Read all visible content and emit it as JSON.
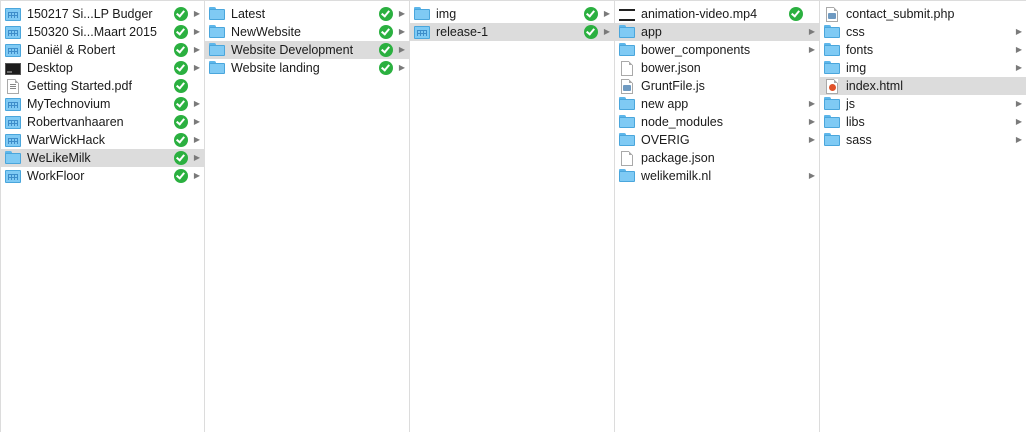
{
  "colors": {
    "selection": "#dcdcdc",
    "check": "#2bb040",
    "folder": "#7fcaf4",
    "border": "#dcdcdc"
  },
  "columns": [
    {
      "items": [
        {
          "name": "150217 Si...LP Budger",
          "icon": "project-folder-icon",
          "synced": true,
          "has_children": true,
          "selected": false
        },
        {
          "name": "150320 Si...Maart 2015",
          "icon": "project-folder-icon",
          "synced": true,
          "has_children": true,
          "selected": false
        },
        {
          "name": "Daniël & Robert",
          "icon": "project-folder-icon",
          "synced": true,
          "has_children": true,
          "selected": false
        },
        {
          "name": "Desktop",
          "icon": "desktop-icon",
          "synced": true,
          "has_children": true,
          "selected": false
        },
        {
          "name": "Getting Started.pdf",
          "icon": "pdf-document-icon",
          "synced": true,
          "has_children": false,
          "selected": false
        },
        {
          "name": "MyTechnovium",
          "icon": "project-folder-icon",
          "synced": true,
          "has_children": true,
          "selected": false
        },
        {
          "name": "Robertvanhaaren",
          "icon": "project-folder-icon",
          "synced": true,
          "has_children": true,
          "selected": false
        },
        {
          "name": "WarWickHack",
          "icon": "project-folder-icon",
          "synced": true,
          "has_children": true,
          "selected": false
        },
        {
          "name": "WeLikeMilk",
          "icon": "folder-icon",
          "synced": true,
          "has_children": true,
          "selected": true
        },
        {
          "name": "WorkFloor",
          "icon": "project-folder-icon",
          "synced": true,
          "has_children": true,
          "selected": false
        }
      ]
    },
    {
      "items": [
        {
          "name": "Latest",
          "icon": "folder-icon",
          "synced": true,
          "has_children": true,
          "selected": false
        },
        {
          "name": "NewWebsite",
          "icon": "folder-icon",
          "synced": true,
          "has_children": true,
          "selected": false
        },
        {
          "name": "Website Development",
          "icon": "folder-icon",
          "synced": true,
          "has_children": true,
          "selected": true
        },
        {
          "name": "Website landing",
          "icon": "folder-icon",
          "synced": true,
          "has_children": true,
          "selected": false
        }
      ]
    },
    {
      "items": [
        {
          "name": "img",
          "icon": "folder-icon",
          "synced": true,
          "has_children": true,
          "selected": false
        },
        {
          "name": "release-1",
          "icon": "project-folder-icon",
          "synced": true,
          "has_children": true,
          "selected": true
        }
      ]
    },
    {
      "items": [
        {
          "name": "animation-video.mp4",
          "icon": "video-file-icon",
          "synced": true,
          "has_children": false,
          "selected": false
        },
        {
          "name": "app",
          "icon": "folder-icon",
          "synced": false,
          "has_children": true,
          "selected": true
        },
        {
          "name": "bower_components",
          "icon": "folder-icon",
          "synced": false,
          "has_children": true,
          "selected": false
        },
        {
          "name": "bower.json",
          "icon": "document-icon",
          "synced": false,
          "has_children": false,
          "selected": false
        },
        {
          "name": "GruntFile.js",
          "icon": "script-document-icon",
          "synced": false,
          "has_children": false,
          "selected": false
        },
        {
          "name": "new app",
          "icon": "folder-icon",
          "synced": false,
          "has_children": true,
          "selected": false
        },
        {
          "name": "node_modules",
          "icon": "folder-icon",
          "synced": false,
          "has_children": true,
          "selected": false
        },
        {
          "name": "OVERIG",
          "icon": "folder-icon",
          "synced": false,
          "has_children": true,
          "selected": false
        },
        {
          "name": "package.json",
          "icon": "document-icon",
          "synced": false,
          "has_children": false,
          "selected": false
        },
        {
          "name": "welikemilk.nl",
          "icon": "folder-icon",
          "synced": false,
          "has_children": true,
          "selected": false
        }
      ]
    },
    {
      "items": [
        {
          "name": "contact_submit.php",
          "icon": "script-document-icon",
          "synced": false,
          "has_children": false,
          "selected": false
        },
        {
          "name": "css",
          "icon": "folder-icon",
          "synced": false,
          "has_children": true,
          "selected": false
        },
        {
          "name": "fonts",
          "icon": "folder-icon",
          "synced": false,
          "has_children": true,
          "selected": false
        },
        {
          "name": "img",
          "icon": "folder-icon",
          "synced": false,
          "has_children": true,
          "selected": false
        },
        {
          "name": "index.html",
          "icon": "html-document-icon",
          "synced": false,
          "has_children": false,
          "selected": true
        },
        {
          "name": "js",
          "icon": "folder-icon",
          "synced": false,
          "has_children": true,
          "selected": false
        },
        {
          "name": "libs",
          "icon": "folder-icon",
          "synced": false,
          "has_children": true,
          "selected": false
        },
        {
          "name": "sass",
          "icon": "folder-icon",
          "synced": false,
          "has_children": true,
          "selected": false
        }
      ]
    }
  ]
}
